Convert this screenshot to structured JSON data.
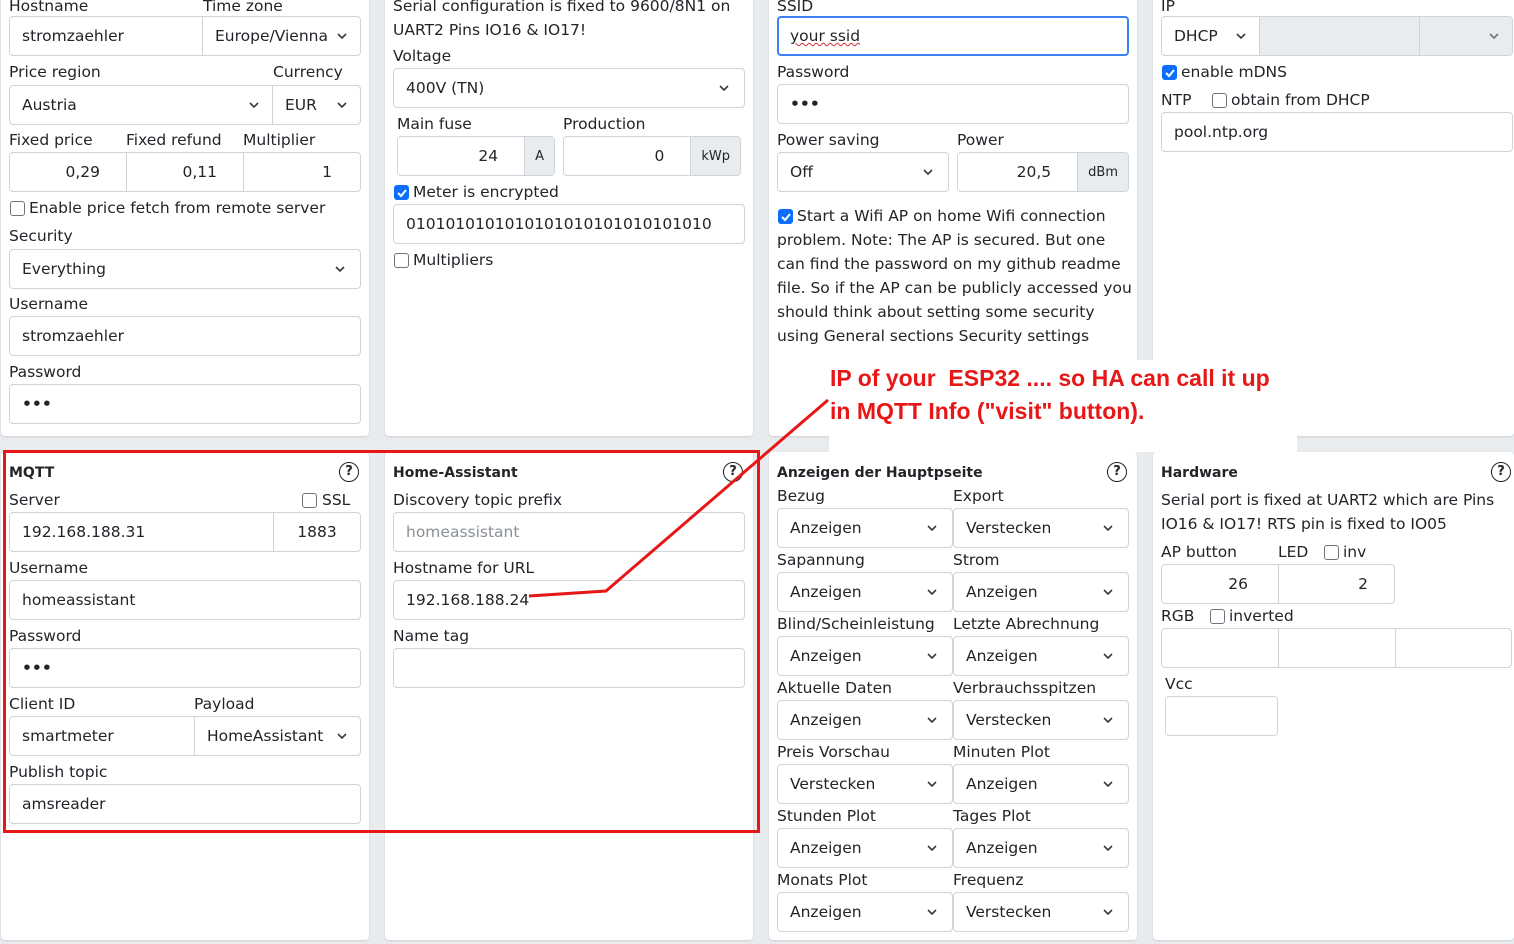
{
  "general": {
    "hostname_label": "Hostname",
    "hostname_value": "stromzaehler",
    "timezone_label": "Time zone",
    "timezone_value": "Europe/Vienna",
    "price_region_label": "Price region",
    "price_region_value": "Austria",
    "currency_label": "Currency",
    "currency_value": "EUR",
    "fixed_price_label": "Fixed price",
    "fixed_price_value": "0,29",
    "fixed_refund_label": "Fixed refund",
    "fixed_refund_value": "0,11",
    "multiplier_label": "Multiplier",
    "multiplier_value": "1",
    "price_fetch_label": "Enable price fetch from remote server",
    "price_fetch_checked": false,
    "security_label": "Security",
    "security_value": "Everything",
    "username_label": "Username",
    "username_value": "stromzaehler",
    "password_label": "Password",
    "password_value": "•••"
  },
  "meter": {
    "serial_text": "Serial configuration is fixed to 9600/8N1 on UART2 Pins IO16 & IO17!",
    "voltage_label": "Voltage",
    "voltage_value": "400V (TN)",
    "main_fuse_label": "Main fuse",
    "main_fuse_value": "24",
    "main_fuse_unit": "A",
    "production_label": "Production",
    "production_value": "0",
    "production_unit": "kWp",
    "encrypted_label": "Meter is encrypted",
    "encrypted_checked": true,
    "key_value": "0101010101010101010101010101010",
    "multipliers_label": "Multipliers",
    "multipliers_checked": false
  },
  "wifi": {
    "ssid_label": "SSID",
    "ssid_value": "your ssid",
    "password_label": "Password",
    "password_value": "•••",
    "power_saving_label": "Power saving",
    "power_saving_value": "Off",
    "power_label": "Power",
    "power_value": "20,5",
    "power_unit": "dBm",
    "ap_checked": true,
    "ap_text": "Start a Wifi AP on home Wifi connection problem. Note: The AP is secured. But one can find the password on my github readme file. So if the AP can be publicly accessed you should think about setting some security using General sections Security settings"
  },
  "network": {
    "ip_label": "IP",
    "ip_mode": "DHCP",
    "mdns_label": "enable mDNS",
    "mdns_checked": true,
    "ntp_label": "NTP",
    "ntp_dhcp_label": "obtain from DHCP",
    "ntp_dhcp_checked": false,
    "ntp_server": "pool.ntp.org"
  },
  "mqtt": {
    "title": "MQTT",
    "server_label": "Server",
    "ssl_label": "SSL",
    "ssl_checked": false,
    "server_value": "192.168.188.31",
    "port_value": "1883",
    "username_label": "Username",
    "username_value": "homeassistant",
    "password_label": "Password",
    "password_value": "•••",
    "client_id_label": "Client ID",
    "client_id_value": "smartmeter",
    "payload_label": "Payload",
    "payload_value": "HomeAssistant",
    "publish_topic_label": "Publish topic",
    "publish_topic_value": "amsreader"
  },
  "home_assistant": {
    "title": "Home-Assistant",
    "discovery_label": "Discovery topic prefix",
    "discovery_placeholder": "homeassistant",
    "hostname_label": "Hostname for URL",
    "hostname_value": "192.168.188.24",
    "name_tag_label": "Name tag",
    "name_tag_value": ""
  },
  "display": {
    "title": "Anzeigen der Hauptpseite",
    "items": [
      {
        "label": "Bezug",
        "value": "Anzeigen"
      },
      {
        "label": "Export",
        "value": "Verstecken"
      },
      {
        "label": "Sapannung",
        "value": "Anzeigen"
      },
      {
        "label": "Strom",
        "value": "Anzeigen"
      },
      {
        "label": "Blind/Scheinleistung",
        "value": "Anzeigen"
      },
      {
        "label": "Letzte Abrechnung",
        "value": "Anzeigen"
      },
      {
        "label": "Aktuelle Daten",
        "value": "Anzeigen"
      },
      {
        "label": "Verbrauchsspitzen",
        "value": "Verstecken"
      },
      {
        "label": "Preis Vorschau",
        "value": "Verstecken"
      },
      {
        "label": "Minuten Plot",
        "value": "Anzeigen"
      },
      {
        "label": "Stunden Plot",
        "value": "Anzeigen"
      },
      {
        "label": "Tages Plot",
        "value": "Anzeigen"
      },
      {
        "label": "Monats Plot",
        "value": "Anzeigen"
      },
      {
        "label": "Frequenz",
        "value": "Verstecken"
      }
    ]
  },
  "hardware": {
    "title": "Hardware",
    "serial_text": "Serial port is fixed at UART2 which are Pins IO16 & IO17! RTS pin is fixed to IO05",
    "ap_button_label": "AP button",
    "led_label": "LED",
    "inv_label": "inv",
    "inv_checked": false,
    "ap_button_value": "26",
    "led_value": "2",
    "rgb_label": "RGB",
    "rgb_inverted_label": "inverted",
    "rgb_inverted_checked": false,
    "vcc_label": "Vcc"
  },
  "annotation": {
    "line1": "IP of your  ESP32 .... so HA can call it up",
    "line2": "in MQTT Info (\"visit\" button).",
    "color": "#e81717"
  },
  "colors": {
    "accent": "#0d6efd",
    "focus": "#3b82f6",
    "annotation": "#e81717",
    "background": "#e9ecef"
  }
}
